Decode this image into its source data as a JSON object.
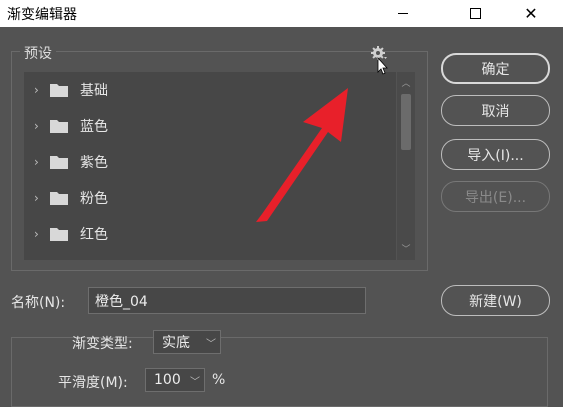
{
  "window": {
    "title": "渐变编辑器"
  },
  "presets": {
    "legend": "预设",
    "items": [
      {
        "label": "基础"
      },
      {
        "label": "蓝色"
      },
      {
        "label": "紫色"
      },
      {
        "label": "粉色"
      },
      {
        "label": "红色"
      }
    ]
  },
  "buttons": {
    "ok": "确定",
    "cancel": "取消",
    "import": "导入(I)...",
    "export": "导出(E)...",
    "new": "新建(W)"
  },
  "name": {
    "label": "名称(N):",
    "value": "橙色_04"
  },
  "gradient": {
    "type_label": "渐变类型:",
    "type_value": "实底",
    "smoothness_label": "平滑度(M):",
    "smoothness_value": "100",
    "smoothness_unit": "%"
  },
  "colors": {
    "annotation_arrow": "#e8202a",
    "background": "#535353"
  }
}
